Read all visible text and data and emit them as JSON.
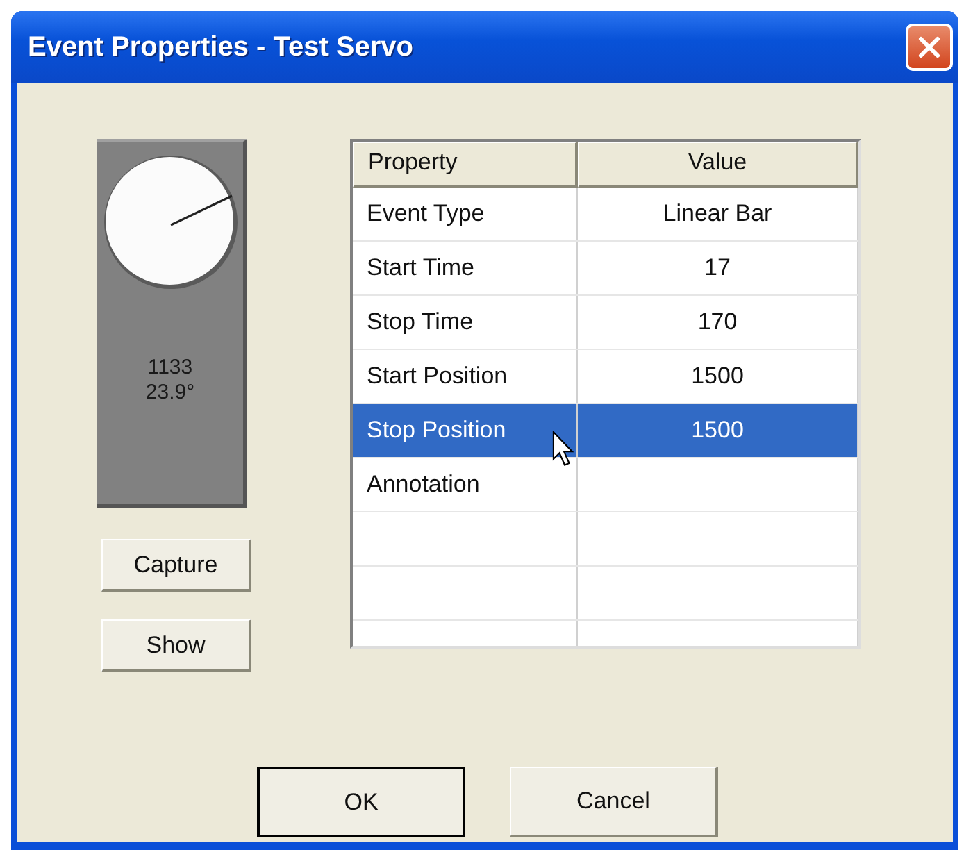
{
  "window": {
    "title": "Event Properties - Test Servo"
  },
  "servo": {
    "reading": "1133",
    "angle": "23.9°"
  },
  "side_buttons": [
    "Capture",
    "Show"
  ],
  "table": {
    "columns": [
      "Property",
      "Value"
    ],
    "rows": [
      {
        "property": "Event Type",
        "value": "Linear Bar",
        "selected": false
      },
      {
        "property": "Start Time",
        "value": "17",
        "selected": false
      },
      {
        "property": "Stop Time",
        "value": "170",
        "selected": false
      },
      {
        "property": "Start Position",
        "value": "1500",
        "selected": false
      },
      {
        "property": "Stop Position",
        "value": "1500",
        "selected": true
      },
      {
        "property": "Annotation",
        "selected": false
      }
    ]
  },
  "buttons": [
    {
      "label": "OK",
      "default": true
    },
    {
      "label": "Cancel",
      "default": false
    }
  ]
}
